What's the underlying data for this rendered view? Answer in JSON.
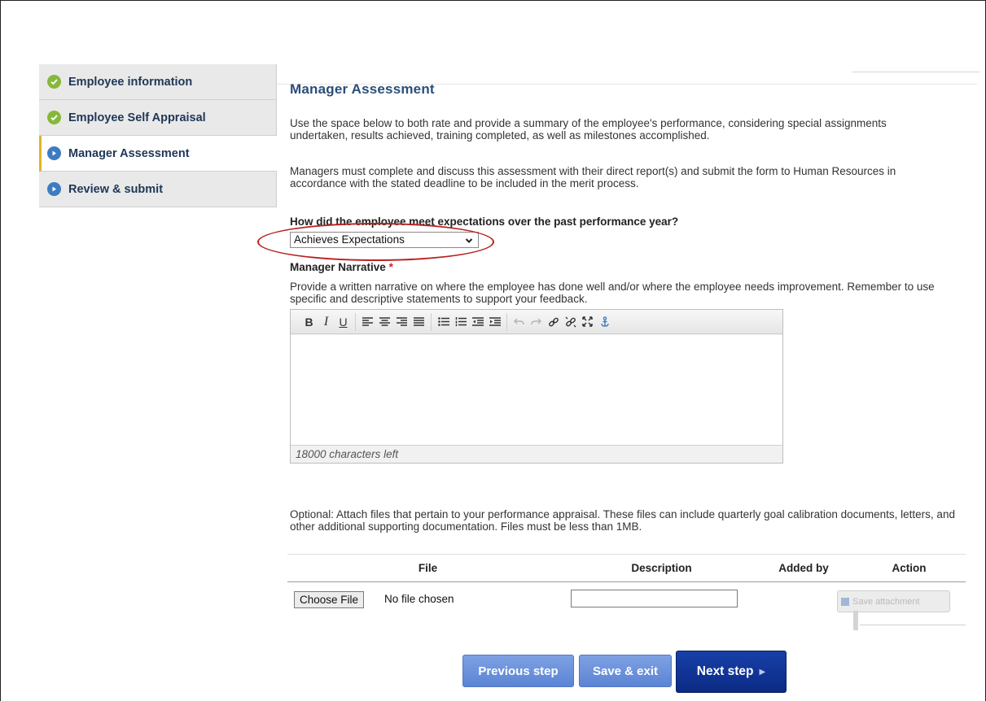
{
  "sidebar": {
    "items": [
      {
        "label": "Employee information",
        "state": "complete",
        "icon": "check-circle-icon"
      },
      {
        "label": "Employee Self Appraisal",
        "state": "complete",
        "icon": "check-circle-icon"
      },
      {
        "label": "Manager Assessment",
        "state": "current",
        "icon": "step-circle-icon"
      },
      {
        "label": "Review & submit",
        "state": "pending",
        "icon": "step-circle-icon"
      }
    ]
  },
  "main": {
    "title": "Manager Assessment",
    "intro": "Use the space below to both rate and provide a summary of the employee's performance, considering special assignments undertaken, results achieved, training completed, as well as milestones accomplished.",
    "instructions": "Managers must complete and discuss this assessment with their direct report(s) and submit the form to Human Resources in accordance with the stated deadline to be included in the merit process.",
    "question": "How did the employee meet expectations over the past performance year?",
    "rating_value": "Achieves Expectations",
    "narrative_label": "Manager Narrative",
    "required_mark": "*",
    "narrative_help": "Provide a written narrative on where the employee has done well and/or where the employee needs improvement. Remember to use specific and descriptive statements to support your feedback.",
    "chars_left": "18000 characters left",
    "attach_note": "Optional: Attach files that pertain to your performance appraisal. These files can include quarterly goal calibration documents, letters, and other additional supporting documentation. Files must be less than 1MB."
  },
  "toolbar": {
    "bold": "B",
    "italic": "I",
    "underline": "U"
  },
  "files": {
    "headers": {
      "file": "File",
      "description": "Description",
      "added_by": "Added by",
      "action": "Action"
    },
    "choose_label": "Choose File",
    "no_file": "No file chosen",
    "save_label": "Save attachment"
  },
  "footer": {
    "prev": "Previous step",
    "save": "Save & exit",
    "next": "Next step"
  },
  "colors": {
    "accent": "#2a4e7a",
    "complete": "#86b83a",
    "step": "#3d7cc2",
    "highlight": "#b8211f",
    "primary_button": "#0b2a84"
  }
}
